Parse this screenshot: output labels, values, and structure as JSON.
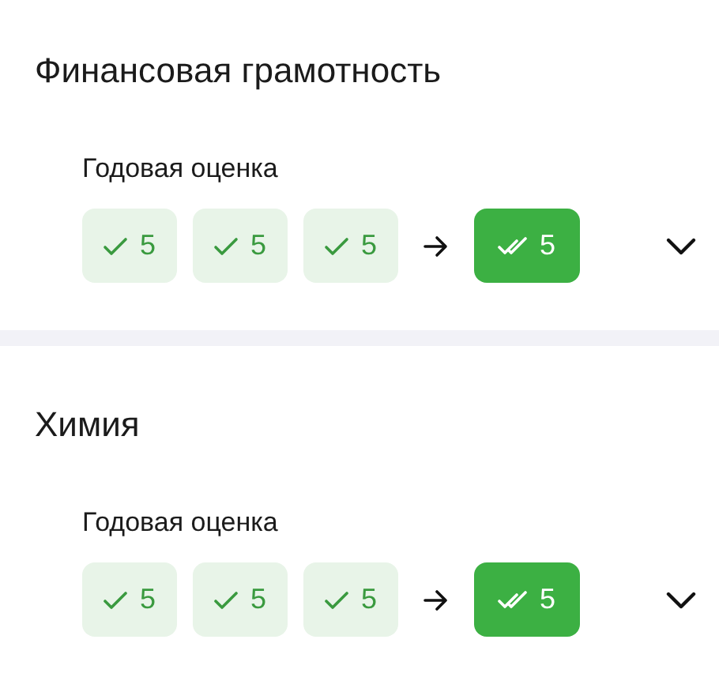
{
  "subjects": [
    {
      "title": "Финансовая грамотность",
      "label": "Годовая оценка",
      "grades": [
        "5",
        "5",
        "5"
      ],
      "final_grade": "5",
      "expanded": false
    },
    {
      "title": "Химия",
      "label": "Годовая оценка",
      "grades": [
        "5",
        "5",
        "5"
      ],
      "final_grade": "5",
      "expanded": false
    }
  ]
}
